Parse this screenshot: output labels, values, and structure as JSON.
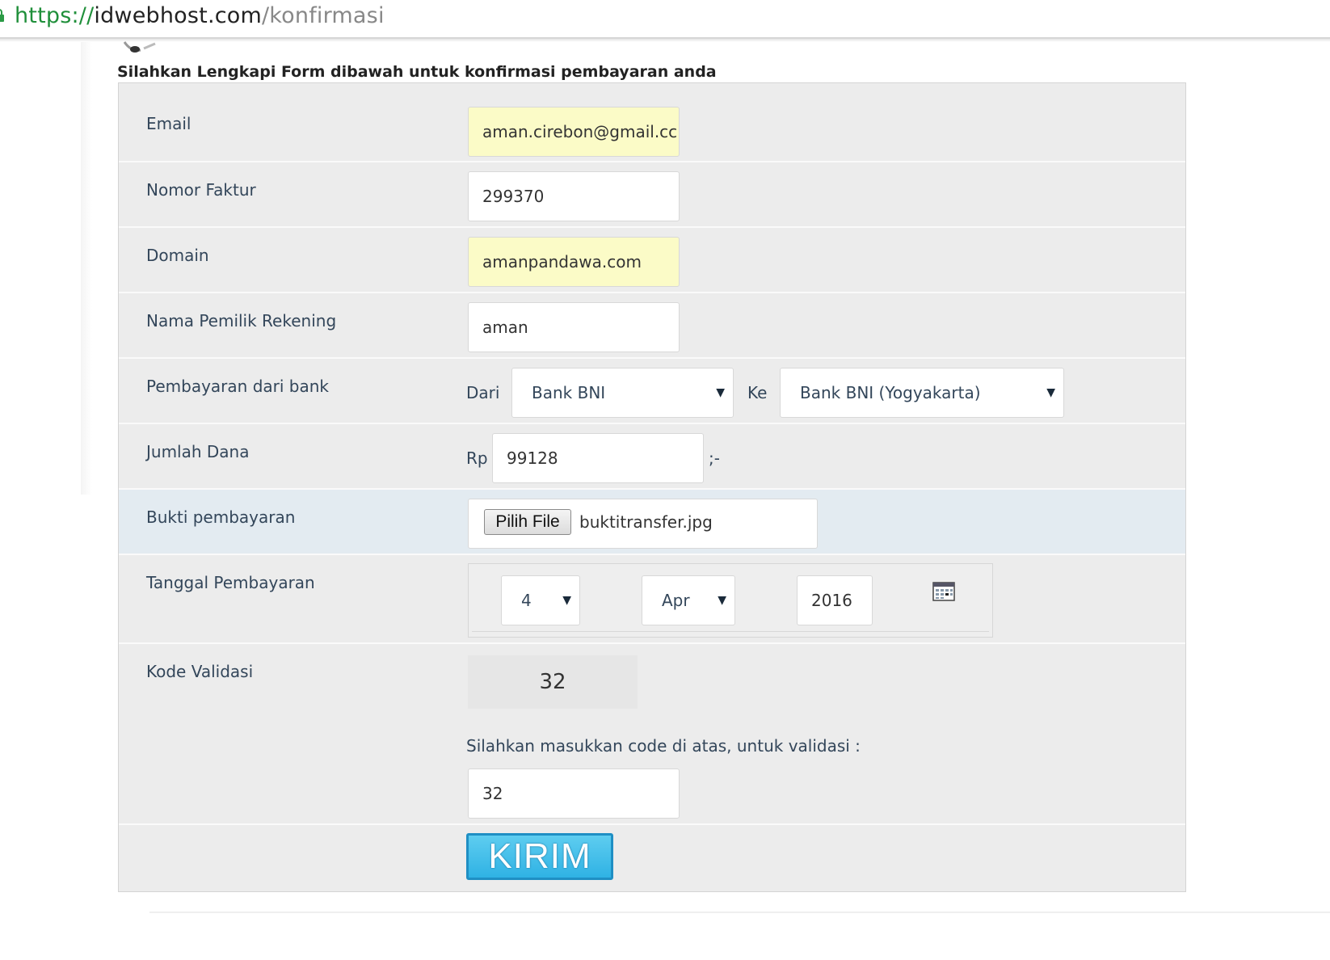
{
  "browser": {
    "url_scheme": "https://",
    "url_host": "idwebhost.com",
    "url_path": "/konfirmasi"
  },
  "heading": "Silahkan Lengkapi Form dibawah untuk konfirmasi pembayaran anda",
  "form": {
    "email": {
      "label": "Email",
      "value": "aman.cirebon@gmail.cc"
    },
    "nomor_faktur": {
      "label": "Nomor Faktur",
      "value": "299370"
    },
    "domain": {
      "label": "Domain",
      "value": "amanpandawa.com"
    },
    "nama_pemilik": {
      "label": "Nama Pemilik Rekening",
      "value": "aman"
    },
    "bank": {
      "label": "Pembayaran dari bank",
      "from_label": "Dari",
      "from_value": "Bank BNI",
      "to_label": "Ke",
      "to_value": "Bank BNI (Yogyakarta)"
    },
    "jumlah": {
      "label": "Jumlah Dana",
      "prefix": "Rp",
      "value": "99128",
      "suffix": ";-"
    },
    "bukti": {
      "label": "Bukti pembayaran",
      "button": "Pilih File",
      "filename": "buktitransfer.jpg"
    },
    "tanggal": {
      "label": "Tanggal Pembayaran",
      "day": "4",
      "month": "Apr",
      "year": "2016"
    },
    "validasi": {
      "label": "Kode Validasi",
      "captcha": "32",
      "instruction": "Silahkan masukkan code di atas, untuk validasi :",
      "value": "32"
    },
    "submit": "KIRIM"
  },
  "icons": {
    "calendar": "calendar-icon",
    "lock": "lock-icon",
    "dropdown": "chevron-down-icon"
  }
}
